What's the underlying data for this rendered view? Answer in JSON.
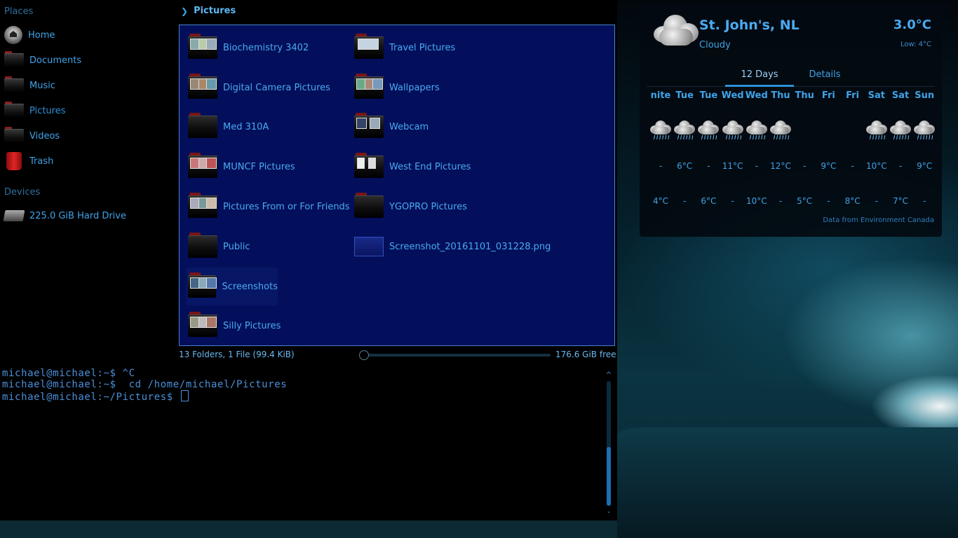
{
  "sidebar": {
    "places_title": "Places",
    "places": [
      {
        "label": "Home",
        "icon": "home-icon"
      },
      {
        "label": "Documents",
        "icon": "folder-icon"
      },
      {
        "label": "Music",
        "icon": "folder-icon"
      },
      {
        "label": "Pictures",
        "icon": "folder-icon",
        "active": true
      },
      {
        "label": "Videos",
        "icon": "folder-icon"
      },
      {
        "label": "Trash",
        "icon": "trash-icon"
      }
    ],
    "devices_title": "Devices",
    "devices": [
      {
        "label": "225.0 GiB Hard Drive",
        "icon": "hard-drive-icon"
      }
    ]
  },
  "breadcrumb": {
    "current": "Pictures"
  },
  "files": [
    {
      "name": "Biochemistry 3402",
      "type": "folder"
    },
    {
      "name": "Digital Camera Pictures",
      "type": "folder"
    },
    {
      "name": "Med 310A",
      "type": "folder"
    },
    {
      "name": "MUNCF Pictures",
      "type": "folder"
    },
    {
      "name": "Pictures From or For Friends",
      "type": "folder"
    },
    {
      "name": "Public",
      "type": "folder"
    },
    {
      "name": "Screenshots",
      "type": "folder"
    },
    {
      "name": "Silly Pictures",
      "type": "folder"
    },
    {
      "name": "Travel Pictures",
      "type": "folder"
    },
    {
      "name": "Wallpapers",
      "type": "folder"
    },
    {
      "name": "Webcam",
      "type": "folder"
    },
    {
      "name": "West End Pictures",
      "type": "folder"
    },
    {
      "name": "YGOPRO Pictures",
      "type": "folder"
    },
    {
      "name": "Screenshot_20161101_031228.png",
      "type": "image-file"
    }
  ],
  "statusbar": {
    "summary": "13 Folders, 1 File (99.4 KiB)",
    "free_space": "176.6 GiB free"
  },
  "terminal": {
    "lines": [
      "michael@michael:~$ ^C",
      "michael@michael:~$  cd /home/michael/Pictures",
      "michael@michael:~/Pictures$ "
    ]
  },
  "weather": {
    "city": "St. John's, NL",
    "condition": "Cloudy",
    "temperature": "3.0°C",
    "low": "Low: 4°C",
    "tabs": [
      "12 Days",
      "Details"
    ],
    "forecast": [
      {
        "day": "nite",
        "icon": "rain-cloud-icon",
        "high": "-",
        "low": "4°C"
      },
      {
        "day": "Tue",
        "icon": "rain-cloud-icon",
        "high": "6°C",
        "low": "-"
      },
      {
        "day": "Tue",
        "icon": "rain-cloud-icon",
        "high": "-",
        "low": "6°C"
      },
      {
        "day": "Wed",
        "icon": "rain-cloud-icon",
        "high": "11°C",
        "low": "-"
      },
      {
        "day": "Wed",
        "icon": "rain-cloud-icon",
        "high": "-",
        "low": "10°C"
      },
      {
        "day": "Thu",
        "icon": "rain-cloud-icon",
        "high": "12°C",
        "low": "-"
      },
      {
        "day": "Thu",
        "icon": "",
        "high": "-",
        "low": "5°C"
      },
      {
        "day": "Fri",
        "icon": "",
        "high": "9°C",
        "low": "-"
      },
      {
        "day": "Fri",
        "icon": "",
        "high": "-",
        "low": "8°C"
      },
      {
        "day": "Sat",
        "icon": "rain-cloud-icon",
        "high": "10°C",
        "low": "-"
      },
      {
        "day": "Sat",
        "icon": "rain-cloud-icon",
        "high": "-",
        "low": "7°C"
      },
      {
        "day": "Sun",
        "icon": "rain-cloud-icon",
        "high": "9°C",
        "low": "-"
      }
    ],
    "source": "Data from Environment Canada"
  },
  "colors": {
    "accent": "#3fa3e8",
    "file_view_bg": "#030f5a",
    "selection_border": "#4a7fd0"
  }
}
